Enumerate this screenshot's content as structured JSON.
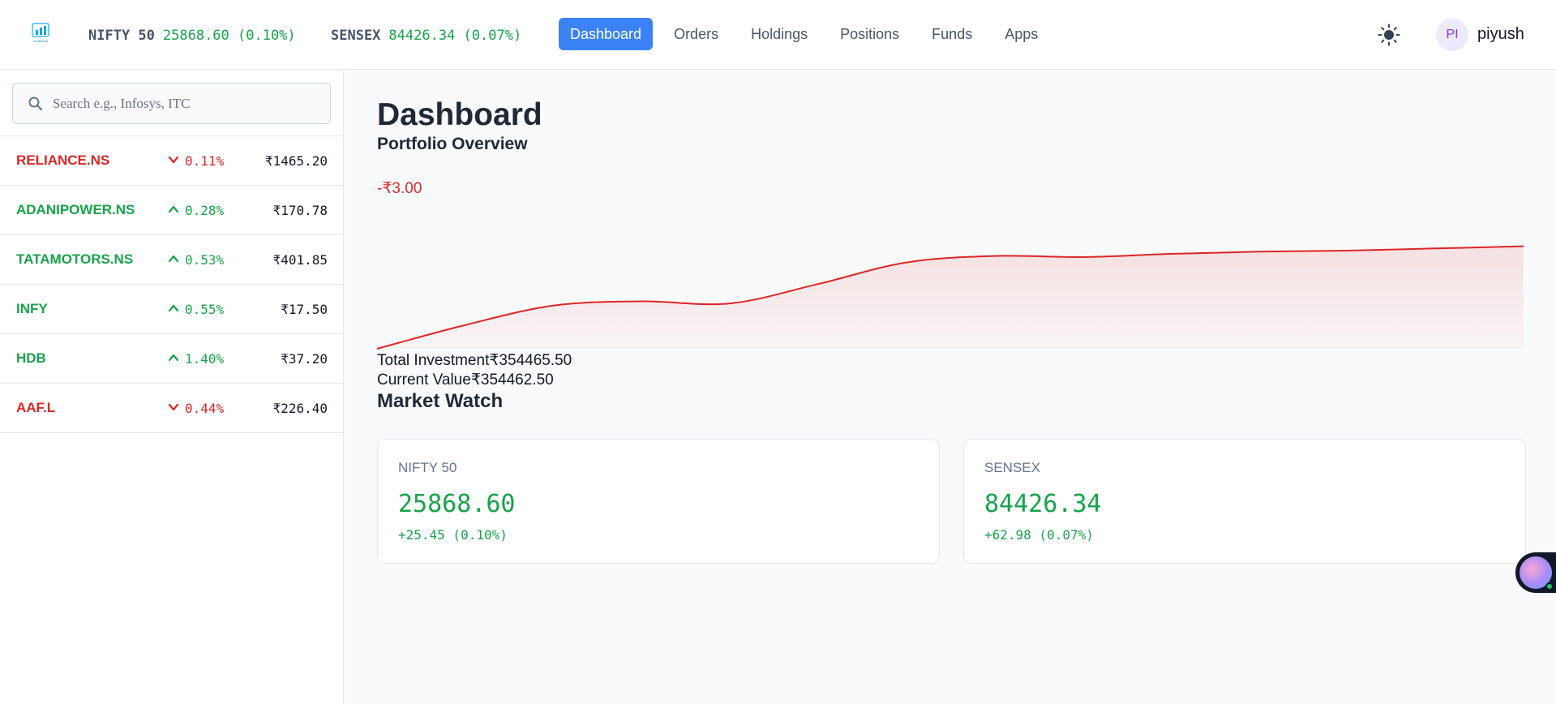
{
  "header": {
    "logo_text": "TradeZero",
    "tickers": [
      {
        "name": "NIFTY 50",
        "value": "25868.60 (0.10%)"
      },
      {
        "name": "SENSEX",
        "value": "84426.34 (0.07%)"
      }
    ],
    "nav": [
      "Dashboard",
      "Orders",
      "Holdings",
      "Positions",
      "Funds",
      "Apps"
    ],
    "active_nav": "Dashboard",
    "theme_icon": "sun-icon",
    "user": {
      "initials": "PI",
      "name": "piyush"
    }
  },
  "sidebar": {
    "search_placeholder": "Search e.g., Infosys, ITC",
    "watchlist": [
      {
        "symbol": "RELIANCE.NS",
        "direction": "down",
        "pct": "0.11%",
        "price": "₹1465.20"
      },
      {
        "symbol": "ADANIPOWER.NS",
        "direction": "up",
        "pct": "0.28%",
        "price": "₹170.78"
      },
      {
        "symbol": "TATAMOTORS.NS",
        "direction": "up",
        "pct": "0.53%",
        "price": "₹401.85"
      },
      {
        "symbol": "INFY",
        "direction": "up",
        "pct": "0.55%",
        "price": "₹17.50"
      },
      {
        "symbol": "HDB",
        "direction": "up",
        "pct": "1.40%",
        "price": "₹37.20"
      },
      {
        "symbol": "AAF.L",
        "direction": "down",
        "pct": "0.44%",
        "price": "₹226.40"
      }
    ]
  },
  "main": {
    "title": "Dashboard",
    "subtitle": "Portfolio Overview",
    "pnl": "-₹3.00",
    "total_investment_label": "Total Investment",
    "total_investment": "₹354465.50",
    "current_value_label": "Current Value",
    "current_value": "₹354462.50",
    "market_watch_title": "Market Watch",
    "market_cards": [
      {
        "name": "NIFTY 50",
        "value": "25868.60",
        "change": "+25.45 (0.10%)"
      },
      {
        "name": "SENSEX",
        "value": "84426.34",
        "change": "+62.98 (0.07%)"
      }
    ]
  },
  "colors": {
    "up": "#16a34a",
    "down": "#dc2626",
    "accent": "#3b82f6"
  },
  "chart_data": {
    "type": "area",
    "series": [
      {
        "values": [
          0,
          0.22,
          0.4,
          0.44,
          0.42,
          0.6,
          0.8,
          0.86,
          0.85,
          0.88,
          0.9,
          0.91,
          0.93,
          0.95
        ]
      }
    ],
    "color": "#dc2626",
    "xlabel": "",
    "ylabel": ""
  }
}
